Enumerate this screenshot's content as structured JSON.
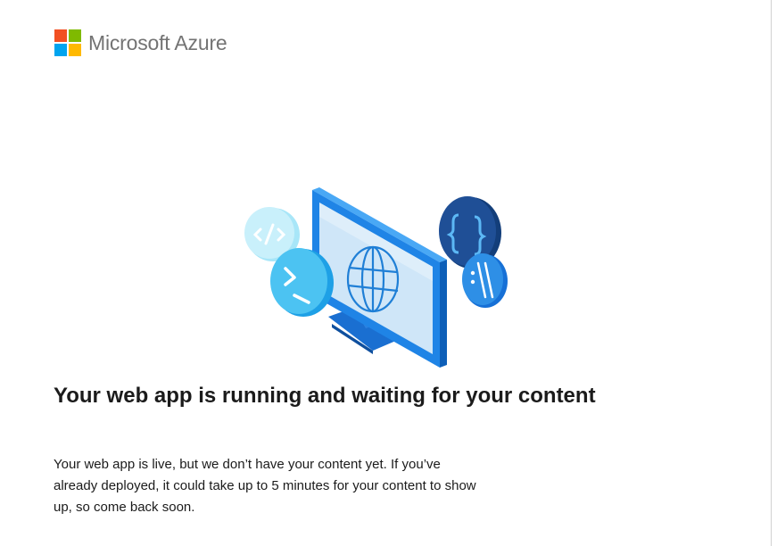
{
  "brand": {
    "name": "Microsoft Azure",
    "logo_colors": [
      "#f25022",
      "#7fba00",
      "#00a4ef",
      "#ffb900"
    ]
  },
  "illustration": {
    "name": "web-app-monitor-illustration",
    "icons": [
      "code-tag-icon",
      "terminal-prompt-icon",
      "curly-braces-icon",
      "comment-slash-icon",
      "globe-icon"
    ]
  },
  "headline": "Your web app is running and waiting for your content",
  "body_lines": [
    "Your web app is live, but we don’t have your content yet. If you’ve",
    "already deployed, it could take up to 5 minutes for your content to show",
    "up, so come back soon."
  ]
}
